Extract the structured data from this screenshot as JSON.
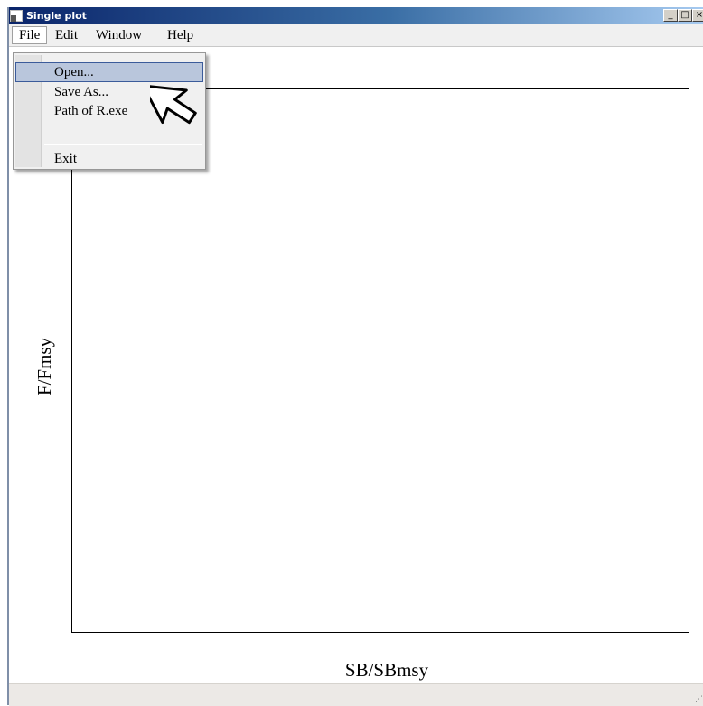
{
  "window": {
    "title": "Single plot",
    "controls": {
      "minimize": "_",
      "maximize": "□",
      "close": "×"
    }
  },
  "menubar": {
    "items": [
      {
        "label": "File"
      },
      {
        "label": "Edit"
      },
      {
        "label": "Window"
      },
      {
        "label": "Help"
      }
    ]
  },
  "file_menu": {
    "items": [
      {
        "label": "Open..."
      },
      {
        "label": "Save As..."
      },
      {
        "label": "Path of R.exe"
      },
      {
        "label": "Exit"
      }
    ],
    "highlighted": "Open..."
  },
  "plot": {
    "xlabel": "SB/SBmsy",
    "ylabel": "F/Fmsy"
  },
  "statusbar": {
    "grip_icon": "resize-grip-icon"
  },
  "colors": {
    "titlebar_start": "#0a246a",
    "titlebar_end": "#a6caf0",
    "menu_highlight": "#b9c6dc"
  }
}
